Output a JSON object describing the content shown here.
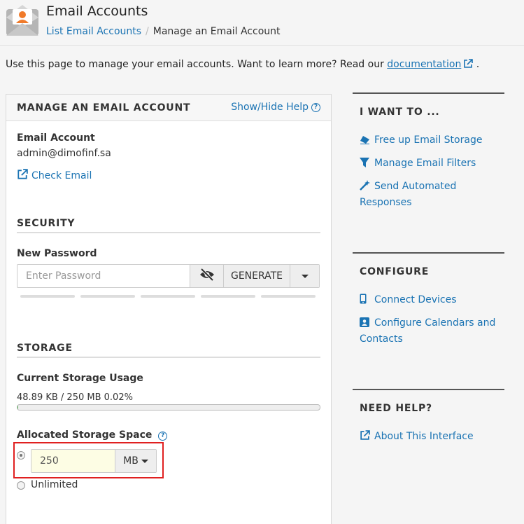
{
  "header": {
    "title": "Email Accounts",
    "breadcrumb": {
      "parent": "List Email Accounts",
      "current": "Manage an Email Account"
    }
  },
  "intro": {
    "text": "Use this page to manage your email accounts. Want to learn more? Read our",
    "link": "documentation",
    "suffix": "."
  },
  "panel": {
    "title": "MANAGE AN EMAIL ACCOUNT",
    "help_toggle": "Show/Hide Help",
    "account": {
      "label": "Email Account",
      "value": "admin@dimofinf.sa",
      "check_email": "Check Email"
    },
    "security": {
      "title": "SECURITY",
      "new_password_label": "New Password",
      "password_placeholder": "Enter Password",
      "generate_label": "GENERATE"
    },
    "storage": {
      "title": "STORAGE",
      "current_label": "Current Storage Usage",
      "usage_text": "48.89 KB / 250 MB 0.02%",
      "usage_fraction": 0.0002,
      "allocated_label": "Allocated Storage Space",
      "quota_value": "250",
      "unit": "MB",
      "unlimited_label": "Unlimited",
      "selected_option": "quota"
    }
  },
  "sidebar": {
    "i_want_to": {
      "title": "I WANT TO ...",
      "items": [
        {
          "label": "Free up Email Storage",
          "icon": "eraser-icon"
        },
        {
          "label": "Manage Email Filters",
          "icon": "filter-icon"
        },
        {
          "label": "Send Automated Responses",
          "icon": "magic-wand-icon"
        }
      ]
    },
    "configure": {
      "title": "CONFIGURE",
      "items": [
        {
          "label": "Connect Devices",
          "icon": "mobile-icon"
        },
        {
          "label": "Configure Calendars and Contacts",
          "icon": "contact-card-icon"
        }
      ]
    },
    "need_help": {
      "title": "NEED HELP?",
      "items": [
        {
          "label": "About This Interface",
          "icon": "external-link-icon"
        }
      ]
    }
  },
  "colors": {
    "link": "#1a73b3",
    "highlight": "#e02020",
    "quota_input_bg": "#fdfde4"
  }
}
